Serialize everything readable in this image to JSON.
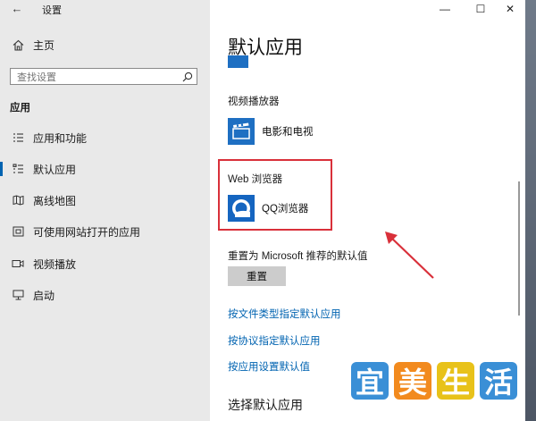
{
  "window": {
    "title": "设置",
    "back_glyph": "←",
    "controls": {
      "minimize": "—",
      "maximize": "☐",
      "close": "✕"
    }
  },
  "sidebar": {
    "home_label": "主页",
    "search_placeholder": "查找设置",
    "section_label": "应用",
    "items": [
      {
        "label": "应用和功能",
        "icon": "list-icon"
      },
      {
        "label": "默认应用",
        "icon": "default-apps-icon",
        "active": true
      },
      {
        "label": "离线地图",
        "icon": "map-icon"
      },
      {
        "label": "可使用网站打开的应用",
        "icon": "website-icon"
      },
      {
        "label": "视频播放",
        "icon": "video-icon"
      },
      {
        "label": "启动",
        "icon": "startup-icon"
      }
    ]
  },
  "main": {
    "heading": "默认应用",
    "video_section_label": "视频播放器",
    "video_app_name": "电影和电视",
    "web_section_label": "Web 浏览器",
    "web_app_name": "QQ浏览器",
    "reset_label": "重置为 Microsoft 推荐的默认值",
    "reset_button": "重置",
    "links": [
      "按文件类型指定默认应用",
      "按协议指定默认应用",
      "按应用设置默认值"
    ],
    "bottom_heading": "选择默认应用"
  },
  "watermark": {
    "chars": [
      "宜",
      "美",
      "生",
      "活"
    ],
    "colors": [
      "#3a8fd6",
      "#f28a1e",
      "#e8c21a",
      "#3a8fd6"
    ]
  },
  "colors": {
    "accent": "#0063b1",
    "annotation_red": "#d9303a"
  }
}
